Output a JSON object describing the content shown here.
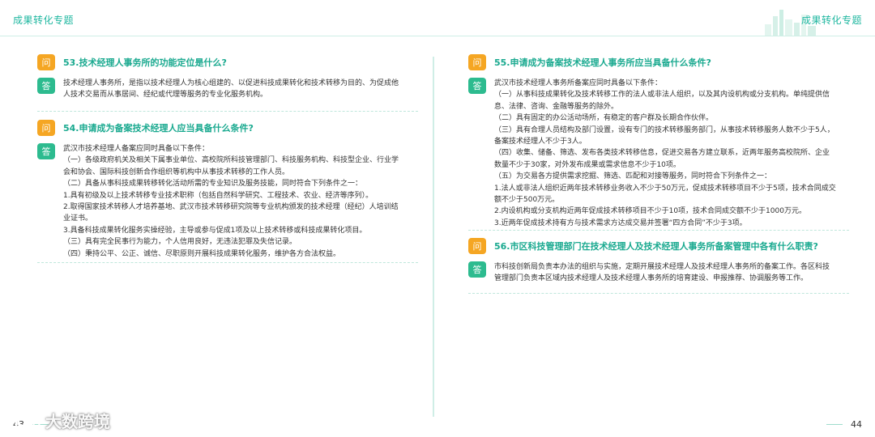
{
  "left": {
    "header": "成果转化专题",
    "page_number": "43",
    "qa": [
      {
        "q_badge": "问",
        "question": "53.技术经理人事务所的功能定位是什么?",
        "a_badge": "答",
        "answer": [
          "技术经理人事务所，是指以技术经理人为核心组建的、以促进科技成果转化和技术转移为目的、为促成他",
          "人技术交易而从事居间、经纪或代理等服务的专业化服务机构。"
        ]
      },
      {
        "q_badge": "问",
        "question": "54.申请成为备案技术经理人应当具备什么条件?",
        "a_badge": "答",
        "answer": [
          "武汉市技术经理人备案应同时具备以下条件：",
          "（一）各级政府机关及相关下属事业单位、高校院所科技管理部门、科技服务机构、科技型企业、行业学",
          "会和协会、国际科技创新合作组织等机构中从事技术转移的工作人员。",
          "（二）具备从事科技成果转移转化活动所需的专业知识及服务技能，同时符合下列条件之一：",
          "1.具有初级及以上技术转移专业技术职称（包括自然科学研究、工程技术、农业、经济等序列）。",
          "2.取得国家技术转移人才培养基地、武汉市技术转移研究院等专业机构颁发的技术经理（经纪）人培训结",
          "业证书。",
          "3.具备科技成果转化服务实操经验，主导或参与促成1项及以上技术转移或科技成果转化项目。",
          "（三）具有完全民事行为能力，个人信用良好，无违法犯罪及失信记录。",
          "（四）秉持公平、公正、诚信、尽职原则开展科技成果转化服务，维护各方合法权益。"
        ]
      }
    ]
  },
  "right": {
    "header": "成果转化专题",
    "page_number": "44",
    "qa": [
      {
        "q_badge": "问",
        "question": "55.申请成为备案技术经理人事务所应当具备什么条件?",
        "a_badge": "答",
        "answer": [
          "武汉市技术经理人事务所备案应同时具备以下条件：",
          "（一）从事科技成果转化及技术转移工作的法人或非法人组织，以及其内设机构或分支机构。单纯提供信",
          "息、法律、咨询、金融等服务的除外。",
          "（二）具有固定的办公活动场所，有稳定的客户群及长期合作伙伴。",
          "（三）具有合理人员结构及部门设置，设有专门的技术转移服务部门，从事技术转移服务人数不少于5人，",
          "备案技术经理人不少于3人。",
          "（四）收集、储备、筛选、发布各类技术转移信息，促进交易各方建立联系，近两年服务高校院所、企业",
          "数量不少于30家，对外发布成果或需求信息不少于10项。",
          "（五）为交易各方提供需求挖掘、筛选、匹配和对接等服务，同时符合下列条件之一：",
          "1.法人或非法人组织近两年技术转移业务收入不少于50万元，促成技术转移项目不少于5项，技术合同成交",
          "额不少于500万元。",
          "2.内设机构或分支机构近两年促成技术转移项目不少于10项，技术合同成交额不少于1000万元。",
          "3.近两年促成技术持有方与技术需求方达成交易并签署“四方合同”不少于3项。"
        ]
      },
      {
        "q_badge": "问",
        "question": "56.市区科技管理部门在技术经理人及技术经理人事务所备案管理中各有什么职责?",
        "a_badge": "答",
        "answer": [
          "市科技创新局负责本办法的组织与实施，定期开展技术经理人及技术经理人事务所的备案工作。各区科技",
          "管理部门负责本区域内技术经理人及技术经理人事务所的培育建设、申报推荐、协调服务等工作。"
        ]
      }
    ]
  },
  "watermark": "大数跨境"
}
